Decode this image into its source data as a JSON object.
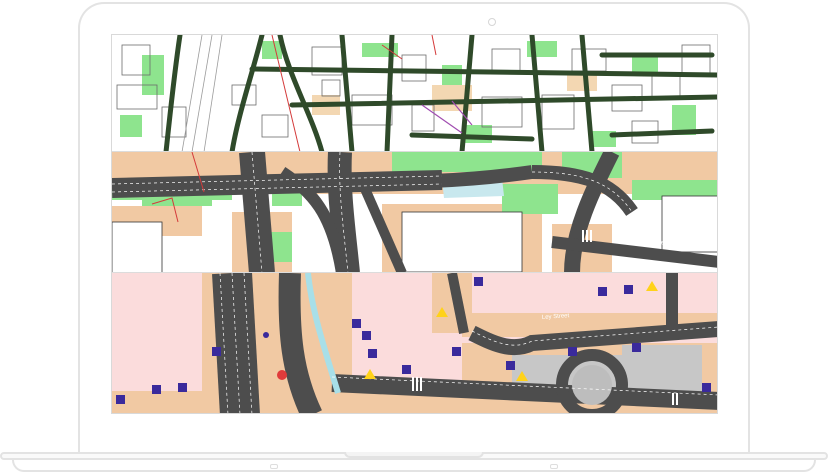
{
  "device": {
    "type": "laptop-mockup"
  },
  "screen": {
    "content": "cad-map-views",
    "panels": [
      {
        "id": "topographic-map",
        "style": "cadastral with buildings and roads"
      },
      {
        "id": "road-design-map",
        "style": "colored road design with curbs"
      },
      {
        "id": "traffic-signage-map",
        "style": "pink background with traffic signs"
      }
    ]
  },
  "colors": {
    "road_dark": "#4d4d4d",
    "road_green": "#2f4a2a",
    "grass": "#8ee48e",
    "sidewalk": "#f1c9a3",
    "building_outline": "#5a5a5a",
    "pink_area": "#fbdcdc",
    "sign_purple": "#3a2a9c",
    "laptop_frame": "#e3e3e3"
  }
}
